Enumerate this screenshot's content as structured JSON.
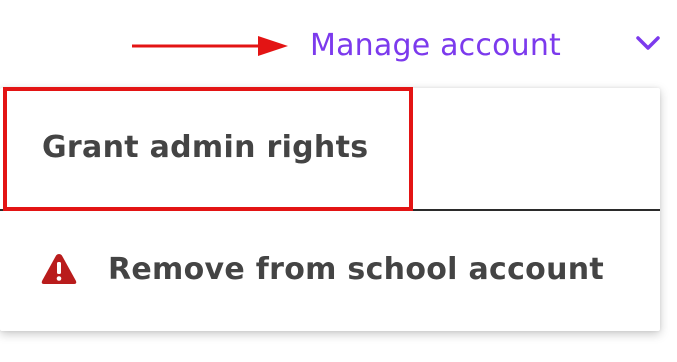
{
  "toggle": {
    "label": "Manage account",
    "icon": "chevron-down-icon",
    "color": "#7c3aed"
  },
  "menu": {
    "items": [
      {
        "label": "Grant admin rights",
        "icon": ""
      },
      {
        "label": "Remove from school account",
        "icon": "warning-icon",
        "icon_color": "#b91c1c"
      }
    ]
  },
  "annotation": {
    "arrow_color": "#e31414",
    "box_color": "#e31414"
  }
}
